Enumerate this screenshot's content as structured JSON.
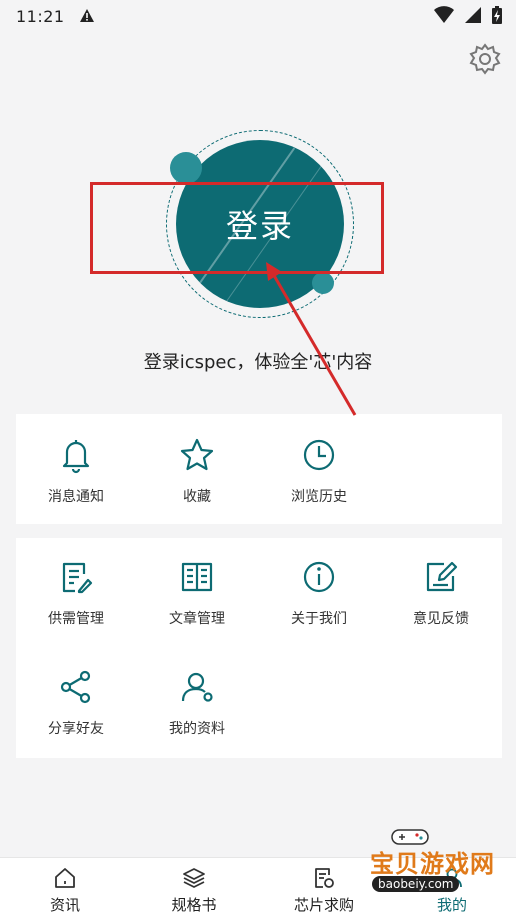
{
  "status_bar": {
    "time": "11:21"
  },
  "login": {
    "button_label": "登录",
    "tagline": "登录icspec，体验全'芯'内容"
  },
  "quick_actions": [
    {
      "label": "消息通知",
      "icon": "bell-icon"
    },
    {
      "label": "收藏",
      "icon": "star-icon"
    },
    {
      "label": "浏览历史",
      "icon": "clock-icon"
    }
  ],
  "services": [
    {
      "label": "供需管理",
      "icon": "edit-document-icon"
    },
    {
      "label": "文章管理",
      "icon": "book-icon"
    },
    {
      "label": "关于我们",
      "icon": "info-icon"
    },
    {
      "label": "意见反馈",
      "icon": "feedback-edit-icon"
    },
    {
      "label": "分享好友",
      "icon": "share-icon"
    },
    {
      "label": "我的资料",
      "icon": "user-profile-icon"
    }
  ],
  "tabbar": [
    {
      "label": "资讯",
      "icon": "home-icon"
    },
    {
      "label": "规格书",
      "icon": "layers-icon"
    },
    {
      "label": "芯片求购",
      "icon": "chip-request-icon"
    },
    {
      "label": "我的",
      "icon": "person-icon"
    }
  ],
  "watermark": {
    "title": "宝贝游戏网",
    "url": "baobeiy.com"
  },
  "colors": {
    "accent": "#0d6b73",
    "accent_light": "#2a8f97",
    "highlight_red": "#d42a2a",
    "background": "#f4f4f5"
  }
}
